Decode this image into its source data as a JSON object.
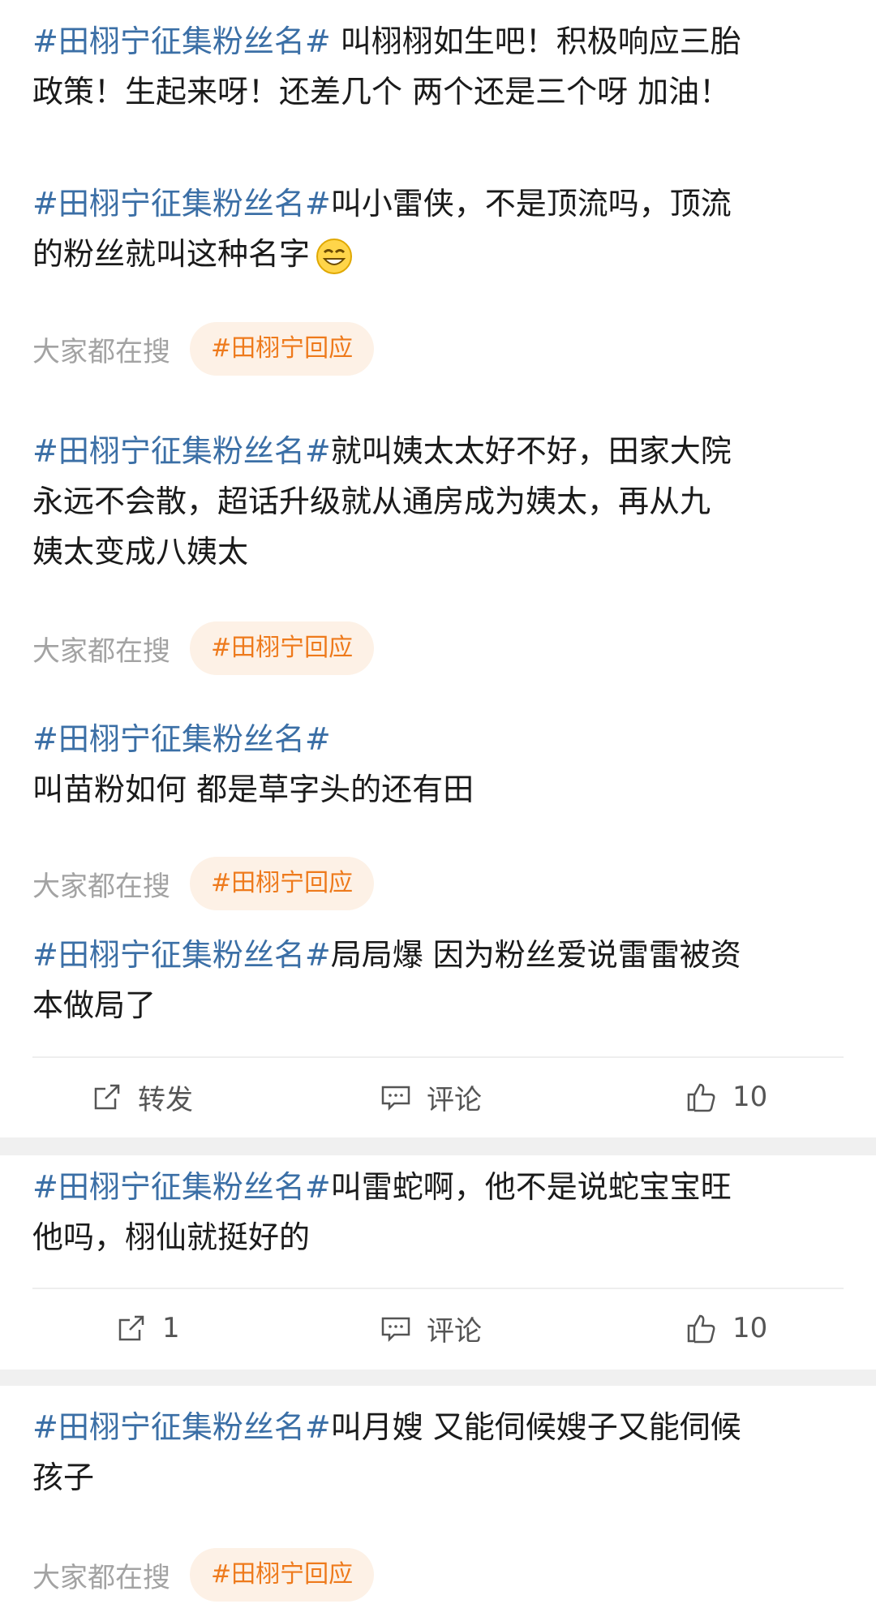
{
  "posts": [
    {
      "hashtag": "#田栩宁征集粉丝名#",
      "text1": " 叫栩栩如生吧！积极响应三胎",
      "text2": "政策！生起来呀！还差几个 两个还是三个呀 加油！"
    },
    {
      "hashtag": "#田栩宁征集粉丝名#",
      "text1": "叫小雷侠，不是顶流吗，顶流",
      "text2": "的粉丝就叫这种名字",
      "emoji": "grin-emoji"
    },
    {
      "hashtag": "#田栩宁征集粉丝名#",
      "text1": "就叫姨太太好不好，田家大院",
      "text2": "永远不会散，超话升级就从通房成为姨太，再从九",
      "text3": "姨太变成八姨太"
    },
    {
      "hashtag": "#田栩宁征集粉丝名#",
      "text2": "叫苗粉如何 都是草字头的还有田"
    },
    {
      "hashtag": "#田栩宁征集粉丝名#",
      "text1": "局局爆 因为粉丝爱说雷雷被资",
      "text2": "本做局了"
    },
    {
      "hashtag": "#田栩宁征集粉丝名#",
      "text1": "叫雷蛇啊，他不是说蛇宝宝旺",
      "text2": "他吗，栩仙就挺好的"
    },
    {
      "hashtag": "#田栩宁征集粉丝名#",
      "text1": "叫月嫂 又能伺候嫂子又能伺候",
      "text2": "孩子"
    }
  ],
  "search": {
    "label": "大家都在搜",
    "tag": "#田栩宁回应"
  },
  "actions1": {
    "repost": "转发",
    "comment": "评论",
    "like": "10"
  },
  "actions2": {
    "repost": "1",
    "comment": "评论",
    "like": "10"
  },
  "colors": {
    "hashtag": "#3b6fa6",
    "pill_bg": "#fdf1e6",
    "pill_text": "#ee7a1c",
    "muted": "#a3a3a3"
  }
}
